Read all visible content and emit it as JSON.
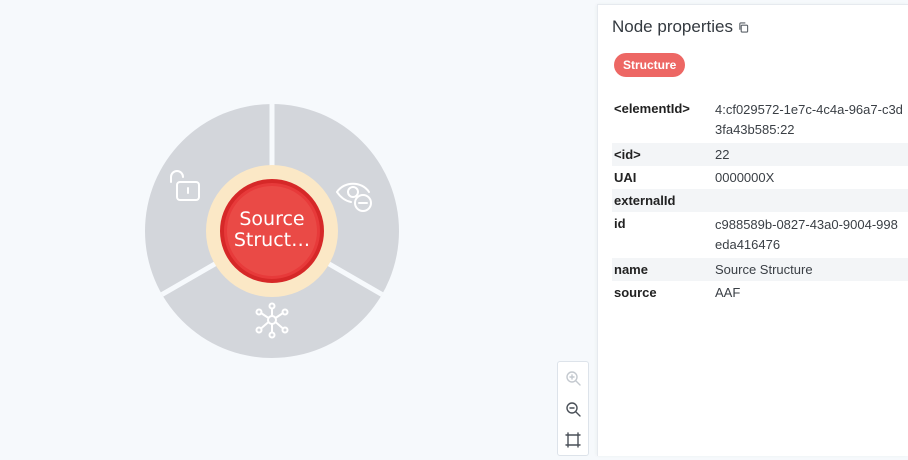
{
  "graph": {
    "node_label_line1": "Source",
    "node_label_line2": "Struct…",
    "node_color": "#e73a3a",
    "node_halo_color": "#fbe8c6",
    "ring_color": "#d3d6db",
    "ring_icons": [
      "unlock-icon",
      "eye-hide-icon",
      "expand-graph-icon"
    ]
  },
  "zoom": {
    "icons": [
      "zoom-in-icon",
      "zoom-out-icon",
      "fit-to-screen-icon"
    ]
  },
  "panel": {
    "title": "Node properties",
    "label_chip": "Structure",
    "label_chip_color": "#ed6764",
    "properties": [
      {
        "key": "<elementId>",
        "value": "4:cf029572-1e7c-4c4a-96a7-c3d3fa43b585:22"
      },
      {
        "key": "<id>",
        "value": "22"
      },
      {
        "key": "UAI",
        "value": "0000000X"
      },
      {
        "key": "externalId",
        "value": ""
      },
      {
        "key": "id",
        "value": "c988589b-0827-43a0-9004-998eda416476"
      },
      {
        "key": "name",
        "value": "Source Structure"
      },
      {
        "key": "source",
        "value": "AAF"
      }
    ]
  }
}
